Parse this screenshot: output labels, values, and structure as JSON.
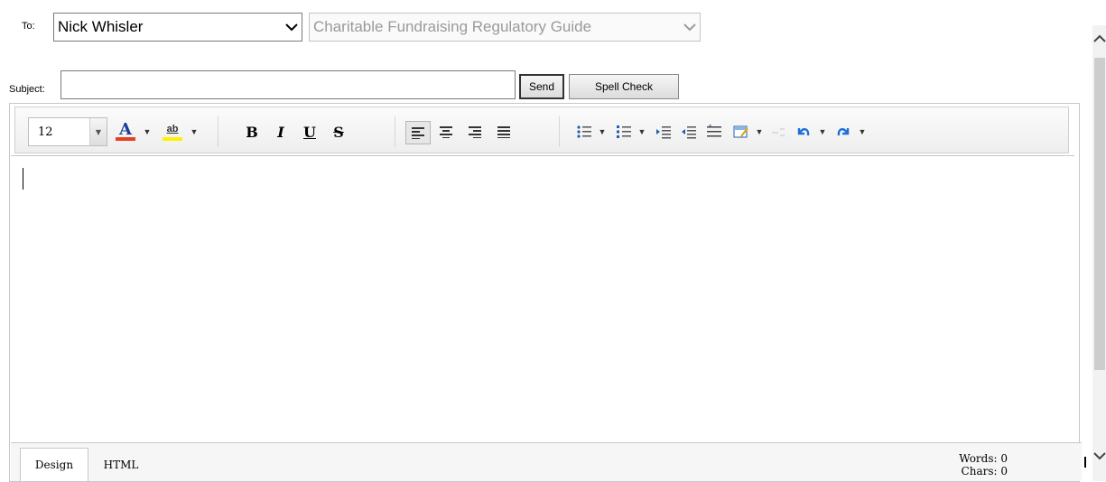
{
  "recipient": {
    "label": "To:",
    "selected": "Nick Whisler"
  },
  "guide": {
    "selected": "Charitable Fundraising Regulatory Guide"
  },
  "subject": {
    "label": "Subject:",
    "value": ""
  },
  "buttons": {
    "send": "Send",
    "spell_check": "Spell Check"
  },
  "toolbar": {
    "font_size": "12",
    "font_color_glyph": "A",
    "font_color": "#e8401c",
    "highlight_glyph": "ab",
    "highlight_color": "#fff200",
    "bold": "B",
    "italic": "I",
    "underline": "U",
    "strike": "S"
  },
  "editor": {
    "content": ""
  },
  "footer": {
    "tabs": [
      "Design",
      "HTML"
    ],
    "words_label": "Words: 0",
    "chars_label": "Chars: 0"
  }
}
